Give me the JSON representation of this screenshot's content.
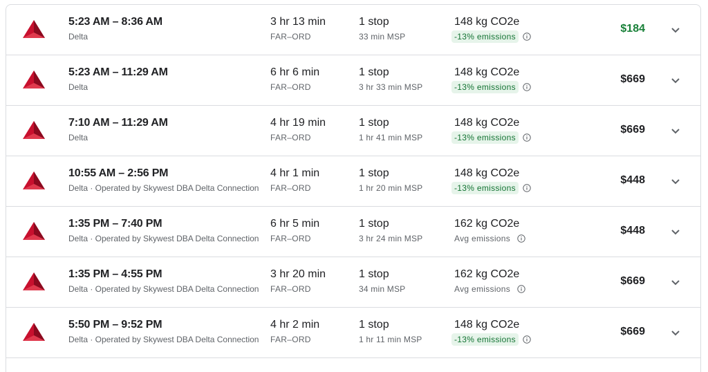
{
  "colors": {
    "delta_red": "#c8102e",
    "cheapest_price": "#188038",
    "low_emissions_text": "#137333",
    "low_emissions_bg": "#e6f4ea"
  },
  "flights": [
    {
      "times": "5:23 AM – 8:36 AM",
      "airline": "Delta",
      "duration": "3 hr 13 min",
      "route": "FAR–ORD",
      "stops": "1 stop",
      "layover": "33 min MSP",
      "co2": "148 kg CO2e",
      "emissions": "-13% emissions",
      "emissions_level": "low",
      "price": "$184",
      "cheapest": true
    },
    {
      "times": "5:23 AM – 11:29 AM",
      "airline": "Delta",
      "duration": "6 hr 6 min",
      "route": "FAR–ORD",
      "stops": "1 stop",
      "layover": "3 hr 33 min MSP",
      "co2": "148 kg CO2e",
      "emissions": "-13% emissions",
      "emissions_level": "low",
      "price": "$669",
      "cheapest": false
    },
    {
      "times": "7:10 AM – 11:29 AM",
      "airline": "Delta",
      "duration": "4 hr 19 min",
      "route": "FAR–ORD",
      "stops": "1 stop",
      "layover": "1 hr 41 min MSP",
      "co2": "148 kg CO2e",
      "emissions": "-13% emissions",
      "emissions_level": "low",
      "price": "$669",
      "cheapest": false
    },
    {
      "times": "10:55 AM – 2:56 PM",
      "airline": "Delta · Operated by Skywest DBA Delta Connection",
      "duration": "4 hr 1 min",
      "route": "FAR–ORD",
      "stops": "1 stop",
      "layover": "1 hr 20 min MSP",
      "co2": "148 kg CO2e",
      "emissions": "-13% emissions",
      "emissions_level": "low",
      "price": "$448",
      "cheapest": false
    },
    {
      "times": "1:35 PM – 7:40 PM",
      "airline": "Delta · Operated by Skywest DBA Delta Connection",
      "duration": "6 hr 5 min",
      "route": "FAR–ORD",
      "stops": "1 stop",
      "layover": "3 hr 24 min MSP",
      "co2": "162 kg CO2e",
      "emissions": "Avg emissions",
      "emissions_level": "avg",
      "price": "$448",
      "cheapest": false
    },
    {
      "times": "1:35 PM – 4:55 PM",
      "airline": "Delta · Operated by Skywest DBA Delta Connection",
      "duration": "3 hr 20 min",
      "route": "FAR–ORD",
      "stops": "1 stop",
      "layover": "34 min MSP",
      "co2": "162 kg CO2e",
      "emissions": "Avg emissions",
      "emissions_level": "avg",
      "price": "$669",
      "cheapest": false
    },
    {
      "times": "5:50 PM – 9:52 PM",
      "airline": "Delta · Operated by Skywest DBA Delta Connection",
      "duration": "4 hr 2 min",
      "route": "FAR–ORD",
      "stops": "1 stop",
      "layover": "1 hr 11 min MSP",
      "co2": "148 kg CO2e",
      "emissions": "-13% emissions",
      "emissions_level": "low",
      "price": "$669",
      "cheapest": false
    }
  ]
}
